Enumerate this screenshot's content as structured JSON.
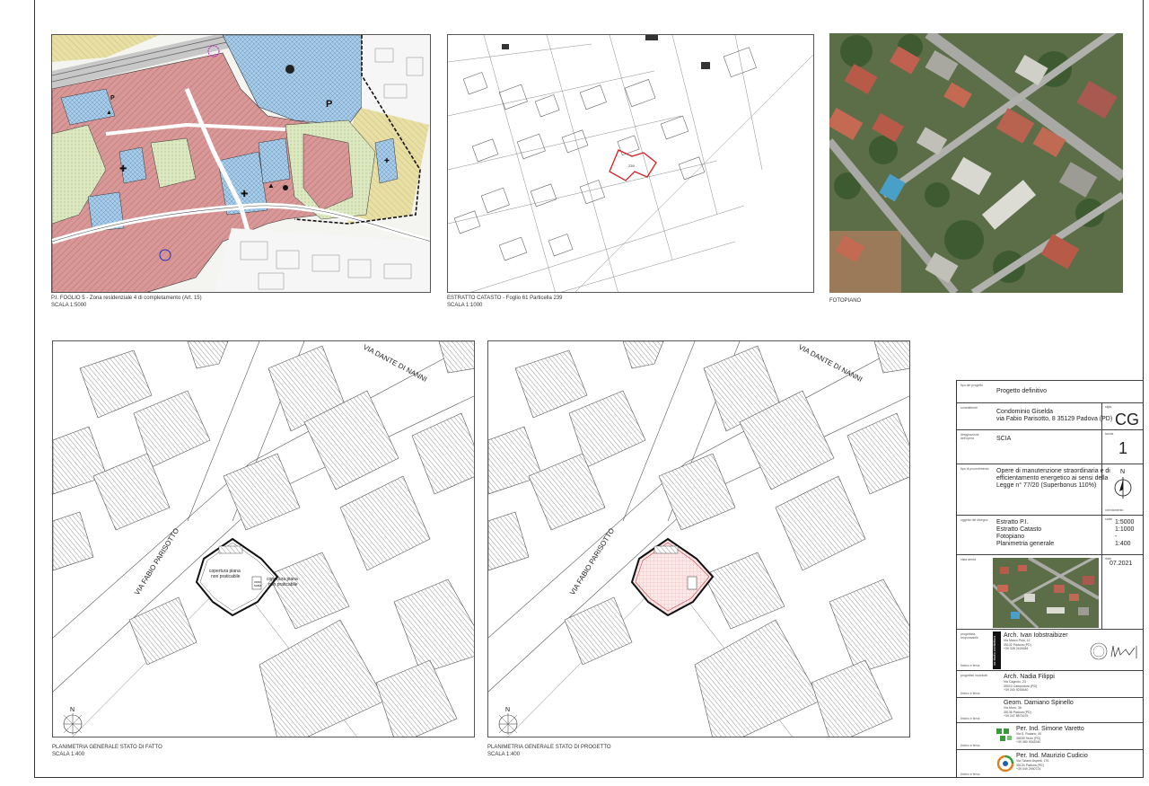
{
  "captions": {
    "pi": {
      "line1": "P.I. FOGLIO 5 - Zona residenziale 4 di completamento (Art. 15)",
      "line2": "SCALA 1:5000"
    },
    "catasto": {
      "line1": "ESTRATTO CATASTO - Foglio 61 Particella 239",
      "line2": "SCALA 1:1000"
    },
    "fotopiano": {
      "line1": "FOTOPIANO"
    },
    "stato_fatto": {
      "line1": "PLANIMETRIA GENERALE STATO DI FATTO",
      "line2": "SCALA 1:400"
    },
    "stato_progetto": {
      "line1": "PLANIMETRIA GENERALE STATO DI PROGETTO",
      "line2": "SCALA 1:400"
    }
  },
  "map_labels": {
    "street_1": "VIA DANTE DI NANNI",
    "street_2": "VIA FABIO PARISOTTO",
    "roof_flat": "copertura piana\nnon praticabile",
    "roof_flat_2": "copertura piana\nnon praticabile",
    "vano_scala": "vano\nscala",
    "north": "N",
    "parcel": "239"
  },
  "title_block": {
    "tipo_progetto_lbl": "tipo del progetto",
    "tipo_progetto": "Progetto definitivo",
    "committente_lbl": "committente",
    "committente_1": "Condominio Giselda",
    "committente_2": "via Fabio Parisotto, 8 35129 Padova (PD)",
    "codice": "CG",
    "codice_lbl": "sigla",
    "designazione_lbl": "designazione dell'opera",
    "designazione": "SCIA",
    "tavola_lbl": "tavola",
    "tavola": "1",
    "tipo_lbl": "tipo di procedimento",
    "descrizione_1": "Opere di manutenzione straordinaria e di",
    "descrizione_2": "efficientamento energetico ai sensi della",
    "descrizione_3": "Legge n° 77/20 (Superbonus 110%)",
    "orientamento_lbl": "orientamento",
    "oggetto_lbl": "oggetto del disegno",
    "oggetti": [
      "Estratto P.I.",
      "Estratto Catasto",
      "Fotopiano",
      "Planimetria generale"
    ],
    "scale_lbl": "scale",
    "scale": [
      "1:5000",
      "1:1000",
      "-",
      "1:400"
    ],
    "data_lbl": "data",
    "data": "07.2021",
    "vista_lbl": "vista aerea",
    "progettista_lbl": "progettista responsabile",
    "timbro_lbl": "timbro e firma",
    "logo_text": "iaz studio architettura",
    "arch1_name": "Arch. Ivan Iobstraibizer",
    "arch1_addr": "Via Marco Polo, 12\n35132 Padova (PD)\n+39 328 2424684",
    "progettisti_lbl": "progettisti incaricati",
    "arch2_name": "Arch. Nadia Filippi",
    "arch2_addr": "Via Cagnolo, 23\n35010 Campodoro (PD)\n+39 340 9243640",
    "geom_name": "Geom. Damiano Spinello",
    "geom_addr": "Via Moro, 36\n35136 Padova (PD)\n+39 347 8871675",
    "per1_name": "Per. Ind. Simone Varetto",
    "per1_addr": "Via S. Rosario, 40\n35030 Teolo (PD)\n+39 380 9343340",
    "per2_name": "Per. Ind. Maurizio Cudicio",
    "per2_addr": "Via Tiziano Aspetti, 176\n35134 Padova (PD)\n+39 049 2950724"
  },
  "colors": {
    "residential": "#d89898",
    "public": "#9fc8e8",
    "green": "#d8e6b8",
    "yellow": "#e6dca0",
    "parcel_red": "#d42020"
  }
}
